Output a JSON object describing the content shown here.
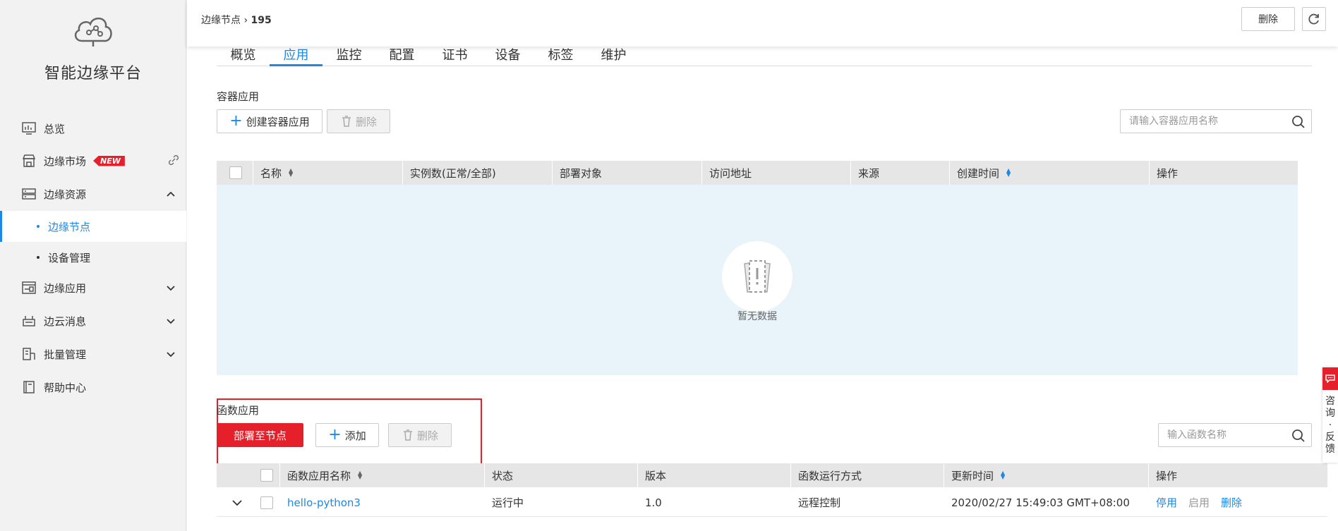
{
  "sidebar": {
    "title": "智能边缘平台",
    "items": [
      {
        "label": "总览",
        "icon": "dashboard-icon"
      },
      {
        "label": "边缘市场",
        "icon": "store-icon",
        "badge": "NEW"
      },
      {
        "label": "边缘资源",
        "icon": "server-icon"
      },
      {
        "label": "边缘应用",
        "icon": "app-icon"
      },
      {
        "label": "边云消息",
        "icon": "message-icon"
      },
      {
        "label": "批量管理",
        "icon": "batch-icon"
      },
      {
        "label": "帮助中心",
        "icon": "help-book-icon"
      }
    ],
    "subitems": [
      {
        "label": "边缘节点",
        "active": true
      },
      {
        "label": "设备管理",
        "active": false
      }
    ]
  },
  "topbar": {
    "breadcrumb_parent": "边缘节点",
    "breadcrumb_sep": "›",
    "breadcrumb_current": "195",
    "delete_label": "删除"
  },
  "tabs": [
    "概览",
    "应用",
    "监控",
    "配置",
    "证书",
    "设备",
    "标签",
    "维护"
  ],
  "active_tab": "应用",
  "container_section": {
    "title": "容器应用",
    "create_label": "创建容器应用",
    "delete_label": "删除",
    "search_placeholder": "请输入容器应用名称",
    "columns": [
      "名称",
      "实例数(正常/全部)",
      "部署对象",
      "访问地址",
      "来源",
      "创建时间",
      "操作"
    ],
    "empty_text": "暂无数据"
  },
  "function_section": {
    "title": "函数应用",
    "deploy_label": "部署至节点",
    "add_label": "添加",
    "delete_label": "删除",
    "search_placeholder": "输入函数名称",
    "columns": [
      "函数应用名称",
      "状态",
      "版本",
      "函数运行方式",
      "更新时间",
      "操作"
    ],
    "rows": [
      {
        "name": "hello-python3",
        "status": "运行中",
        "version": "1.0",
        "run_mode": "远程控制",
        "updated": "2020/02/27 15:49:03 GMT+08:00",
        "actions": [
          "停用",
          "启用",
          "删除"
        ]
      }
    ]
  },
  "feedback": {
    "label_1": "咨",
    "label_2": "询",
    "label_3": "·",
    "label_4": "反",
    "label_5": "馈"
  },
  "colors": {
    "accent": "#1e88e5",
    "danger": "#e5202b",
    "empty_bg": "#e8f4fa"
  }
}
